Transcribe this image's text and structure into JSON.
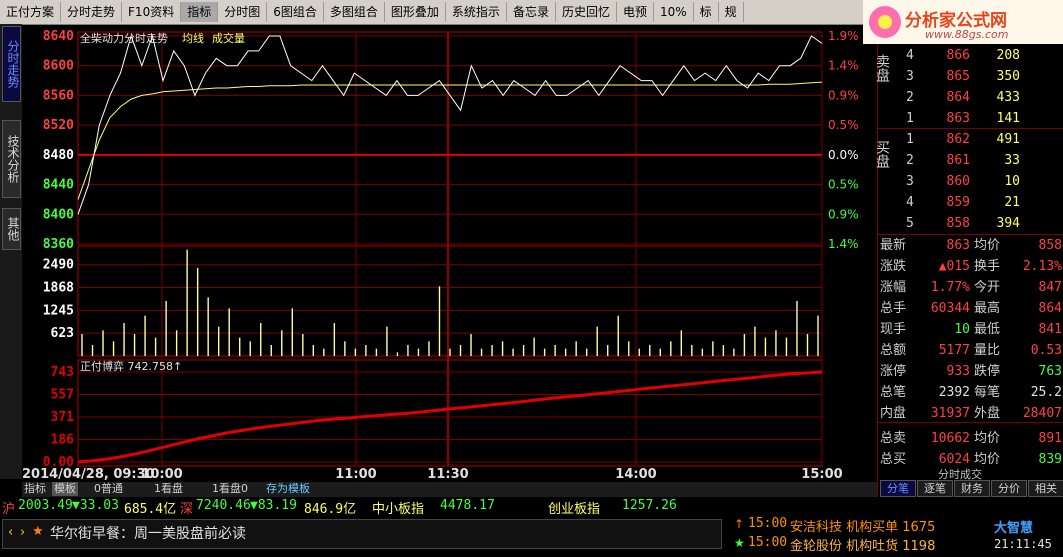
{
  "toolbar": {
    "items": [
      "正付方案",
      "分时走势",
      "F10资料",
      "指标",
      "分时图",
      "6图组合",
      "多图组合",
      "图形叠加",
      "系统指示",
      "备忘录",
      "历史回忆",
      "电预",
      "10%",
      "标",
      "规"
    ],
    "active_index": 3
  },
  "logo": {
    "brand": "分析家公式网",
    "url": "www.88gs.com"
  },
  "left_tabs": [
    "分时走势",
    "技术分析",
    "其他"
  ],
  "chart_title": "全柴动力分时走势",
  "legend": [
    "均线",
    "成交量"
  ],
  "indicator_title": "正付博弈  742.758↑",
  "date_label": "2014/04/28, 09:30",
  "colors": {
    "up": "#ff4040",
    "down": "#40ff40",
    "grid": "#7a0000",
    "price_line": "#ffffff",
    "avg_line": "#ffff66",
    "volume": "#ffffa0",
    "indicator": "#e00000"
  },
  "chart_data": [
    {
      "type": "line",
      "title": "全柴动力分时走势",
      "x_ticks": [
        "10:00",
        "11:00",
        "11:30",
        "14:00",
        "15:00"
      ],
      "prev_close": 8480,
      "y_ticks_left": [
        "8640",
        "8600",
        "8560",
        "8520",
        "8480",
        "8440",
        "8400",
        "8360"
      ],
      "y_ticks_right": [
        "1.9%",
        "1.4%",
        "0.9%",
        "0.5%",
        "0.0%",
        "0.5%",
        "0.9%",
        "1.4%"
      ],
      "ylim": [
        8360,
        8640
      ],
      "series": [
        {
          "name": "price",
          "values": [
            8400,
            8440,
            8520,
            8560,
            8590,
            8640,
            8600,
            8640,
            8580,
            8620,
            8600,
            8560,
            8590,
            8610,
            8600,
            8600,
            8620,
            8620,
            8640,
            8640,
            8600,
            8590,
            8580,
            8600,
            8580,
            8560,
            8590,
            8580,
            8570,
            8560,
            8580,
            8560,
            8560,
            8570,
            8580,
            8560,
            8540,
            8600,
            8570,
            8580,
            8560,
            8580,
            8570,
            8560,
            8580,
            8560,
            8560,
            8570,
            8580,
            8560,
            8580,
            8600,
            8590,
            8580,
            8580,
            8560,
            8580,
            8600,
            8580,
            8590,
            8580,
            8600,
            8580,
            8570,
            8590,
            8580,
            8600,
            8600,
            8610,
            8640,
            8630
          ]
        },
        {
          "name": "avg",
          "values": [
            8420,
            8460,
            8500,
            8530,
            8545,
            8555,
            8560,
            8562,
            8565,
            8566,
            8567,
            8568,
            8569,
            8570,
            8570,
            8571,
            8572,
            8572,
            8573,
            8573,
            8573,
            8574,
            8574,
            8574,
            8574,
            8574,
            8574,
            8574,
            8574,
            8574,
            8574,
            8574,
            8574,
            8574,
            8574,
            8574,
            8574,
            8574,
            8574,
            8574,
            8574,
            8574,
            8574,
            8574,
            8574,
            8574,
            8574,
            8574,
            8574,
            8574,
            8574,
            8574,
            8574,
            8574,
            8574,
            8574,
            8574,
            8574,
            8574,
            8574,
            8574,
            8574,
            8574,
            8574,
            8574,
            8575,
            8575,
            8575,
            8576,
            8577,
            8578
          ]
        }
      ]
    },
    {
      "type": "bar",
      "title": "成交量",
      "y_ticks": [
        "2490",
        "1868",
        "1245",
        "623"
      ],
      "ylim": [
        0,
        3000
      ],
      "values": [
        600,
        300,
        700,
        400,
        900,
        600,
        1100,
        500,
        1500,
        700,
        2900,
        2400,
        1600,
        800,
        1300,
        500,
        400,
        900,
        300,
        700,
        1300,
        600,
        300,
        200,
        900,
        400,
        200,
        300,
        200,
        800,
        100,
        300,
        200,
        400,
        1900,
        200,
        300,
        600,
        200,
        300,
        400,
        200,
        300,
        500,
        200,
        300,
        200,
        400,
        200,
        800,
        300,
        1100,
        400,
        200,
        300,
        200,
        400,
        700,
        300,
        200,
        400,
        300,
        200,
        600,
        800,
        500,
        700,
        500,
        1500,
        600,
        1100
      ]
    },
    {
      "type": "line",
      "title": "正付博弈",
      "y_ticks": [
        "743",
        "557",
        "371",
        "186",
        "0.00"
      ],
      "ylim": [
        0,
        743
      ],
      "series": [
        {
          "name": "正付博弈",
          "values": [
            0,
            10,
            25,
            45,
            70,
            100,
            130,
            160,
            190,
            215,
            240,
            260,
            280,
            295,
            310,
            325,
            340,
            352,
            362,
            372,
            382,
            392,
            400,
            412,
            425,
            438,
            450,
            462,
            475,
            487,
            500,
            515,
            528,
            540,
            552,
            565,
            578,
            590,
            604,
            617,
            630,
            642,
            655,
            668,
            680,
            692,
            705,
            717,
            728,
            735,
            743
          ]
        }
      ]
    }
  ],
  "order_book": {
    "sell_label": "卖盘",
    "buy_label": "买盘",
    "sell": [
      {
        "level": "4",
        "price": "866",
        "volume": "208"
      },
      {
        "level": "3",
        "price": "865",
        "volume": "350"
      },
      {
        "level": "2",
        "price": "864",
        "volume": "433"
      },
      {
        "level": "1",
        "price": "863",
        "volume": "141"
      }
    ],
    "buy": [
      {
        "level": "1",
        "price": "862",
        "volume": "491"
      },
      {
        "level": "2",
        "price": "861",
        "volume": "33"
      },
      {
        "level": "3",
        "price": "860",
        "volume": "10"
      },
      {
        "level": "4",
        "price": "859",
        "volume": "21"
      },
      {
        "level": "5",
        "price": "858",
        "volume": "394"
      }
    ]
  },
  "quotes": [
    {
      "l1": "最新",
      "v1": "863",
      "l2": "均价",
      "v2": "858"
    },
    {
      "l1": "涨跌",
      "v1": "▲015",
      "l2": "换手",
      "v2": "2.13%"
    },
    {
      "l1": "涨幅",
      "v1": "1.77%",
      "l2": "今开",
      "v2": "847"
    },
    {
      "l1": "总手",
      "v1": "60344",
      "l2": "最高",
      "v2": "864"
    },
    {
      "l1": "现手",
      "v1": "10",
      "l2": "最低",
      "v2": "841"
    },
    {
      "l1": "总额",
      "v1": "5177",
      "l2": "量比",
      "v2": "0.53"
    },
    {
      "l1": "涨停",
      "v1": "933",
      "l2": "跌停",
      "v2": "763"
    },
    {
      "l1": "总笔",
      "v1": "2392",
      "l2": "每笔",
      "v2": "25.2"
    },
    {
      "l1": "内盘",
      "v1": "31937",
      "l2": "外盘",
      "v2": "28407"
    },
    {
      "l1": "总卖",
      "v1": "10662",
      "l2": "均价",
      "v2": "891"
    },
    {
      "l1": "总买",
      "v1": "6024",
      "l2": "均价",
      "v2": "839"
    }
  ],
  "right_footer": {
    "title": "分时成交",
    "tabs": [
      "分笔",
      "逐笔",
      "财务",
      "分价",
      "相关"
    ]
  },
  "bottom_tabs": [
    "指标",
    "模板",
    "0普通",
    "1看盘",
    "1看盘0",
    "存为模板"
  ],
  "status": {
    "sh_label": "沪",
    "sh_value": "2003.49",
    "sh_change": "▼33.03",
    "sh_amount": "685.4亿",
    "sz_label": "深",
    "sz_value": "7240.46",
    "sz_change": "▼83.19",
    "sz_amount": "846.9亿",
    "zxb_label": "中小板指",
    "zxb_value": "4478.17",
    "cyb_label": "创业板指",
    "cyb_value": "1257.26"
  },
  "news": {
    "headline": "华尔街早餐：周一美股盘前必读",
    "alerts": [
      {
        "time": "15:00",
        "text": "安洁科技  机构买单 1675"
      },
      {
        "time": "15:00",
        "text": "金轮股份  机构吐货 1198"
      }
    ],
    "brand": "大智慧",
    "clock": "21:11:45"
  }
}
